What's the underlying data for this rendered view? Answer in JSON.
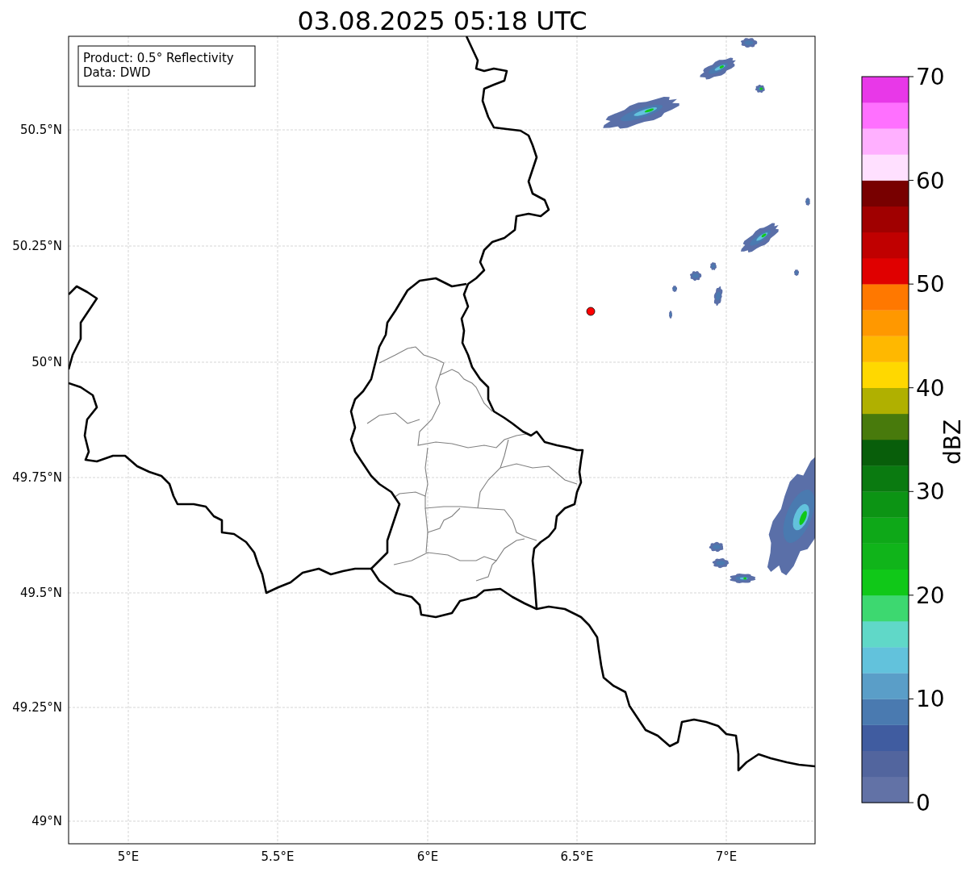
{
  "title": "03.08.2025 05:18 UTC",
  "map": {
    "info_box": [
      "Product: 0.5° Reflectivity",
      "Data: DWD"
    ],
    "lon_ticks": [
      "5°E",
      "5.5°E",
      "6°E",
      "6.5°E",
      "7°E"
    ],
    "lat_ticks": [
      "50.5°N",
      "50.25°N",
      "50°N",
      "49.75°N",
      "49.5°N",
      "49.25°N",
      "49°N"
    ]
  },
  "colorbar": {
    "label": "dBZ",
    "ticks": [
      "70",
      "60",
      "50",
      "40",
      "30",
      "20",
      "10",
      "0"
    ],
    "bands": [
      {
        "color": "#6272a6"
      },
      {
        "color": "#52659e"
      },
      {
        "color": "#405ca0"
      },
      {
        "color": "#4a7ab0"
      },
      {
        "color": "#5a9ec8"
      },
      {
        "color": "#62c2dc"
      },
      {
        "color": "#60d8c8"
      },
      {
        "color": "#3dd870"
      },
      {
        "color": "#10c818"
      },
      {
        "color": "#10b41a"
      },
      {
        "color": "#0ea818"
      },
      {
        "color": "#0c9414"
      },
      {
        "color": "#0a7a10"
      },
      {
        "color": "#085e0a"
      },
      {
        "color": "#487a0c"
      },
      {
        "color": "#b0b000"
      },
      {
        "color": "#ffd800"
      },
      {
        "color": "#ffb800"
      },
      {
        "color": "#ff9800"
      },
      {
        "color": "#ff7800"
      },
      {
        "color": "#e00000"
      },
      {
        "color": "#c00000"
      },
      {
        "color": "#a00000"
      },
      {
        "color": "#780000"
      },
      {
        "color": "#ffe0ff"
      },
      {
        "color": "#ffb0ff"
      },
      {
        "color": "#ff70ff"
      },
      {
        "color": "#e838e8"
      }
    ]
  }
}
